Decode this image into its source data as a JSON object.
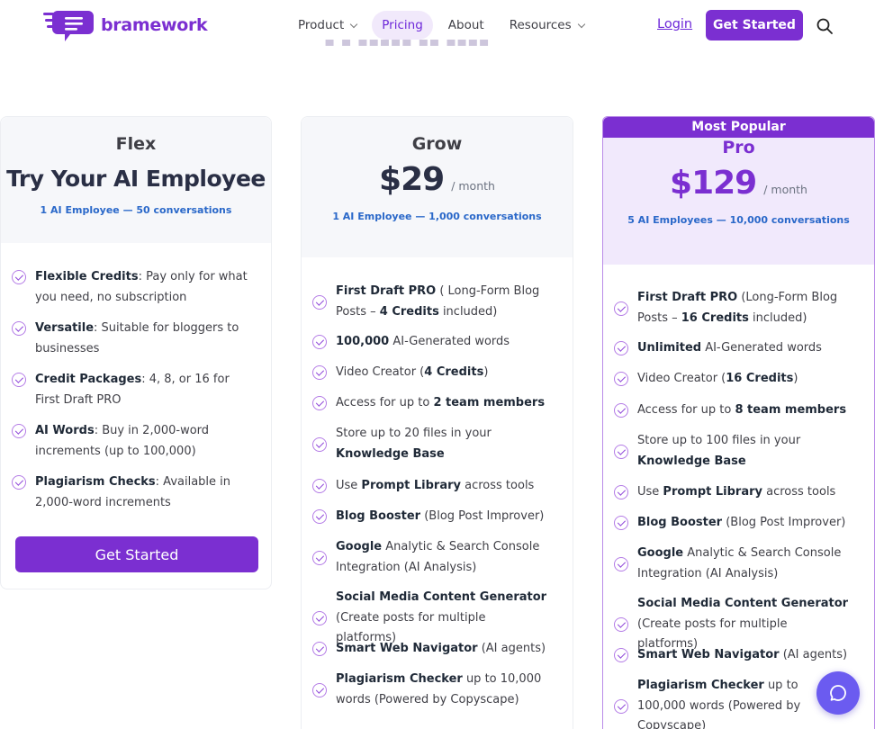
{
  "brand": {
    "name": "bramework",
    "accent": "#7b2fd1"
  },
  "nav": {
    "items": [
      {
        "label": "Product",
        "dropdown": true
      },
      {
        "label": "Pricing",
        "dropdown": false
      },
      {
        "label": "About",
        "dropdown": false
      },
      {
        "label": "Resources",
        "dropdown": true
      }
    ],
    "login": "Login",
    "get_started": "Get Started",
    "search_icon": "search-icon"
  },
  "plans": {
    "flex": {
      "name": "Flex",
      "headline": "Try Your AI Employee",
      "subtitle": "1 AI Employee — 50 conversations",
      "features": [
        {
          "bold": "Flexible Credits",
          "rest": ": Pay only for what you need, no subscription"
        },
        {
          "bold": "Versatile",
          "rest": ": Suitable for bloggers to businesses"
        },
        {
          "bold": "Credit Packages",
          "rest": ": 4, 8, or 16 for First Draft PRO"
        },
        {
          "bold": "AI Words",
          "rest": ": Buy in 2,000-word increments (up to 100,000)"
        },
        {
          "bold": "Plagiarism Checks",
          "rest": ": Available in 2,000-word increments"
        }
      ],
      "button": "Get Started"
    },
    "grow": {
      "name": "Grow",
      "price": "$29",
      "period": "/ month",
      "subtitle": "1 AI Employee — 1,000 conversations",
      "features": [
        {
          "parts": [
            "First Draft PRO",
            " ( Long-Form Blog Posts – ",
            "4 Credits",
            " included)"
          ]
        },
        {
          "parts": [
            "100,000",
            " AI-Generated words"
          ]
        },
        {
          "parts": [
            "",
            "Video Creator (",
            "4 Credits",
            ")"
          ]
        },
        {
          "parts": [
            "",
            "Access for up to ",
            "2 team members",
            ""
          ]
        },
        {
          "parts": [
            "",
            "Store up to 20 files in your ",
            "Knowledge Base",
            ""
          ]
        },
        {
          "parts": [
            "",
            "Use ",
            "Prompt Library",
            " across tools"
          ]
        },
        {
          "parts": [
            "Blog Booster",
            " (Blog Post Improver)"
          ]
        },
        {
          "parts": [
            "Google",
            " Analytic & Search Console Integration (AI Analysis)"
          ]
        },
        {
          "parts": [
            "Social Media Content Generator",
            " (Create posts for multiple platforms)"
          ]
        },
        {
          "parts": [
            "Smart Web Navigator",
            " (AI agents)"
          ]
        },
        {
          "parts": [
            "Plagiarism Checker",
            " up to 10,000 words (Powered by Copyscape)"
          ]
        }
      ]
    },
    "pro": {
      "badge": "Most Popular",
      "name": "Pro",
      "price": "$129",
      "period": "/ month",
      "subtitle": "5 AI Employees — 10,000 conversations",
      "features": [
        {
          "parts": [
            "First Draft PRO",
            " (Long-Form Blog Posts – ",
            "16 Credits",
            " included)"
          ]
        },
        {
          "parts": [
            "Unlimited",
            " AI-Generated words"
          ]
        },
        {
          "parts": [
            "",
            "Video Creator (",
            "16 Credits",
            ")"
          ]
        },
        {
          "parts": [
            "",
            "Access for up to ",
            "8 team members",
            ""
          ]
        },
        {
          "parts": [
            "",
            "Store up to 100 files in your ",
            "Knowledge Base",
            ""
          ]
        },
        {
          "parts": [
            "",
            "Use ",
            "Prompt Library",
            " across tools"
          ]
        },
        {
          "parts": [
            "Blog Booster",
            " (Blog Post Improver)"
          ]
        },
        {
          "parts": [
            "Google",
            " Analytic & Search Console Integration (AI Analysis)"
          ]
        },
        {
          "parts": [
            "Social Media Content Generator",
            " (Create posts for multiple platforms)"
          ]
        },
        {
          "parts": [
            "Smart Web Navigator",
            " (AI agents)"
          ]
        },
        {
          "parts": [
            "Plagiarism Checker",
            " up to 100,000 words (Powered by Copyscape)"
          ]
        }
      ]
    }
  },
  "chat": {
    "icon": "chat-bubble-icon"
  }
}
